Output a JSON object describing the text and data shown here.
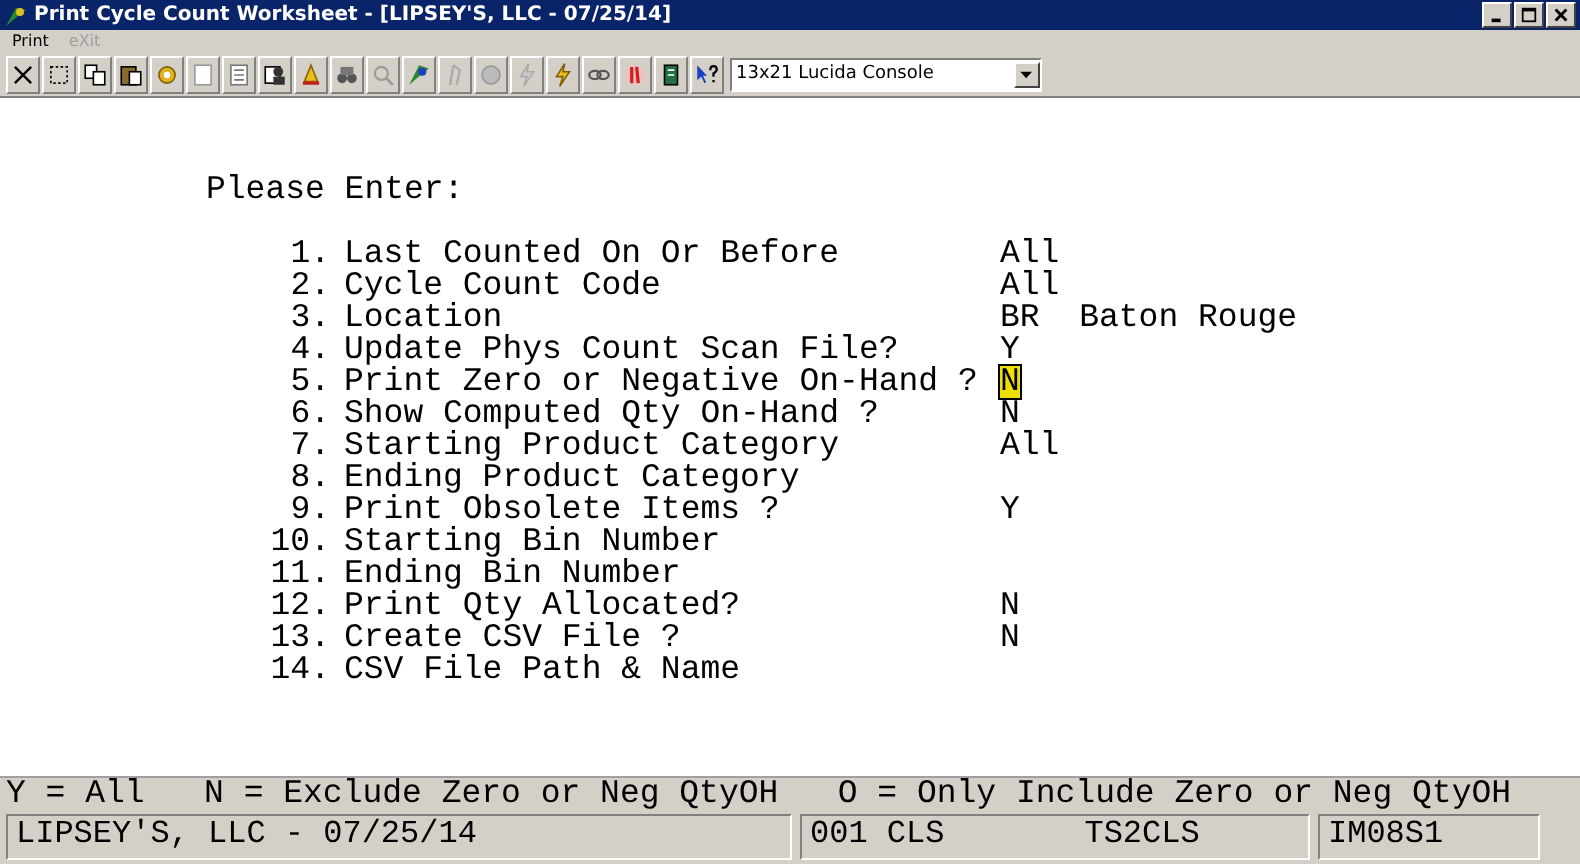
{
  "window": {
    "title": "Print Cycle Count Worksheet - [LIPSEY'S, LLC - 07/25/14]"
  },
  "menu": [
    {
      "label": "Print",
      "disabled": false
    },
    {
      "label": "eXit",
      "disabled": true
    }
  ],
  "toolbar": {
    "font_select": "13x21 Lucida Console"
  },
  "form": {
    "heading": "Please Enter:",
    "fields": [
      {
        "number": "1.",
        "label": "Last Counted On Or Before",
        "value": "All",
        "cursor": false
      },
      {
        "number": "2.",
        "label": "Cycle Count Code",
        "value": "All",
        "cursor": false
      },
      {
        "number": "3.",
        "label": "Location",
        "value": "BR  Baton Rouge",
        "cursor": false
      },
      {
        "number": "4.",
        "label": "Update Phys Count Scan File?",
        "value": "Y",
        "cursor": false
      },
      {
        "number": "5.",
        "label": "Print Zero or Negative On-Hand ?",
        "value": "N",
        "cursor": true
      },
      {
        "number": "6.",
        "label": "Show Computed Qty On-Hand ?",
        "value": "N",
        "cursor": false
      },
      {
        "number": "7.",
        "label": "Starting Product Category",
        "value": "All",
        "cursor": false
      },
      {
        "number": "8.",
        "label": "Ending Product Category"
      },
      {
        "number": "9.",
        "label": "Print Obsolete Items ?",
        "value": "Y",
        "cursor": false
      },
      {
        "number": "10.",
        "label": "Starting Bin Number"
      },
      {
        "number": "11.",
        "label": "Ending Bin Number"
      },
      {
        "number": "12.",
        "label": "Print Qty Allocated?",
        "value": "N",
        "cursor": false
      },
      {
        "number": "13.",
        "label": "Create CSV File ?",
        "value": "N",
        "cursor": false
      },
      {
        "number": "14.",
        "label": "CSV File Path & Name"
      }
    ]
  },
  "hint_line": "Y = All   N = Exclude Zero or Neg QtyOH   O = Only Include Zero or Neg QtyOH",
  "status_bar": {
    "company": "LIPSEY'S, LLC - 07/25/14",
    "session": "001 CLS",
    "terminal": "TS2CLS",
    "program": "IM08S1"
  }
}
